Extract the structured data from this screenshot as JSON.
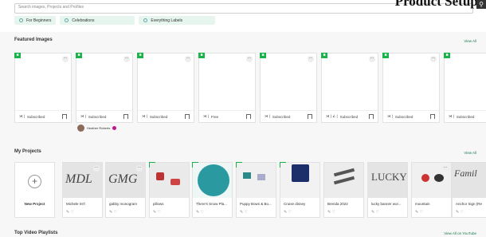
{
  "search": {
    "placeholder": "Search images, Projects and Profiles"
  },
  "overlay_title": "Product Setup.",
  "chips": [
    {
      "label": "For Beginners",
      "icon": "lightbulb-icon"
    },
    {
      "label": "Celebrations",
      "icon": "lightbulb-icon"
    },
    {
      "label": "Everything Labels",
      "icon": "lightbulb-icon"
    }
  ],
  "featured": {
    "title": "Featured Images",
    "view_all": "View All",
    "cards": [
      {
        "status": "Subscribed"
      },
      {
        "status": "Subscribed"
      },
      {
        "status": "Subscribed"
      },
      {
        "status": "Free"
      },
      {
        "status": "Subscribed"
      },
      {
        "status": "Subscribed"
      },
      {
        "status": "Subscribed"
      },
      {
        "status": "Subscribed"
      }
    ],
    "author": "Heather Roberts"
  },
  "projects": {
    "title": "My Projects",
    "view_all": "View All",
    "new_label": "New Project",
    "items": [
      {
        "name": "Michele Int'l",
        "art": "MDL"
      },
      {
        "name": "gabby monogram",
        "art": "GMG"
      },
      {
        "name": "pillows",
        "art": ""
      },
      {
        "name": "There's Snow Pla...",
        "art": ""
      },
      {
        "name": "Puppy Bows & Bo...",
        "art": ""
      },
      {
        "name": "Cruise disney",
        "art": ""
      },
      {
        "name": "Brenda 2022",
        "art": ""
      },
      {
        "name": "lucky banner wor...",
        "art": "LUCKY"
      },
      {
        "name": "mountain",
        "art": ""
      },
      {
        "name": "Anchor Sign (Re",
        "art": "Famil"
      }
    ]
  },
  "playlists": {
    "title": "Top Video Playlists",
    "view_all": "View All on YouTube"
  },
  "colors": {
    "accent": "#1bb24a",
    "chip_bg": "#e6f5ee",
    "link": "#1a7a4c"
  }
}
